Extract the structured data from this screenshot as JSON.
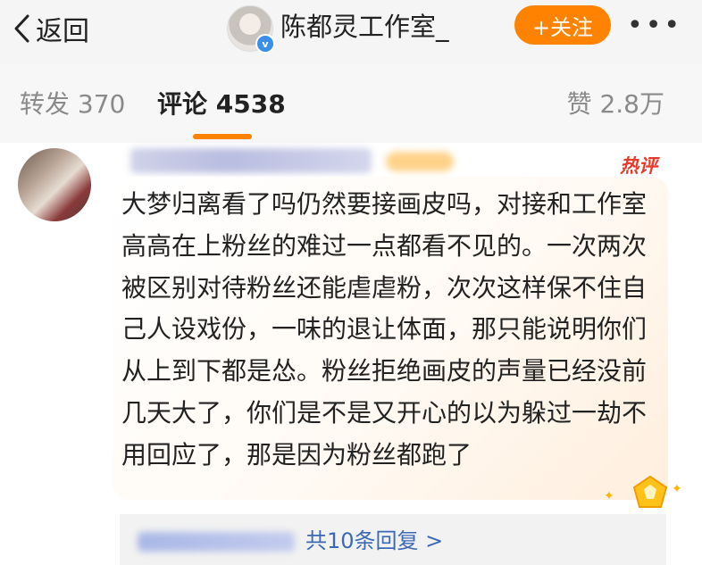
{
  "header": {
    "back_label": "返回",
    "account_name": "陈都灵工作室_",
    "verified_mark": "v",
    "follow_label": "+关注",
    "more_label": "•••"
  },
  "tabs": {
    "repost": "转发 370",
    "comment": "评论 4538",
    "like": "赞 2.8万"
  },
  "comment": {
    "hot_badge": "热评",
    "text": "大梦归离看了吗仍然要接画皮吗，对接和工作室高高在上粉丝的难过一点都看不见的。一次两次被区别对待粉丝还能虐虐粉，次次这样保不住自己人设戏份，一味的退让体面，那只能说明你们从上到下都是怂。粉丝拒绝画皮的声量已经没前几天大了，你们是不是又开心的以为躲过一劫不用回应了，那是因为粉丝都跑了",
    "replies_link": "共10条回复 >"
  },
  "colors": {
    "accent": "#ff8200",
    "hot": "#e83a2a",
    "link": "#3c69b6",
    "verified": "#3a8fe8"
  }
}
